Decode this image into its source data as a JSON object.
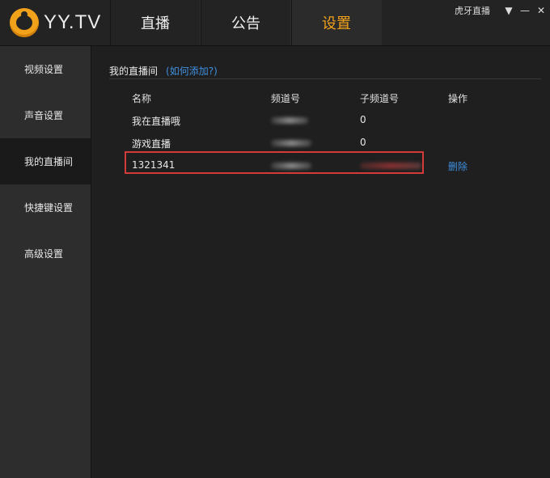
{
  "header": {
    "logo_text": "YY.TV",
    "tabs": [
      {
        "label": "直播",
        "active": false
      },
      {
        "label": "公告",
        "active": false
      },
      {
        "label": "设置",
        "active": true
      }
    ],
    "window_title": "虎牙直播",
    "accent_color": "#f2a11b"
  },
  "sidebar": {
    "items": [
      {
        "label": "视频设置",
        "active": false
      },
      {
        "label": "声音设置",
        "active": false
      },
      {
        "label": "我的直播间",
        "active": true
      },
      {
        "label": "快捷键设置",
        "active": false
      },
      {
        "label": "高级设置",
        "active": false
      }
    ]
  },
  "content": {
    "section_title": "我的直播间",
    "help_link": "(如何添加?)",
    "table": {
      "columns": [
        "名称",
        "频道号",
        "子频道号",
        "操作"
      ],
      "rows": [
        {
          "name": "我在直播哦",
          "channel": "",
          "subchannel": "0",
          "action": ""
        },
        {
          "name": "游戏直播",
          "channel": "",
          "subchannel": "0",
          "action": ""
        },
        {
          "name": "1321341",
          "channel": "",
          "subchannel": "",
          "action": "删除"
        }
      ]
    },
    "highlight_color": "#d43a3a",
    "link_color": "#3f8fe0"
  }
}
